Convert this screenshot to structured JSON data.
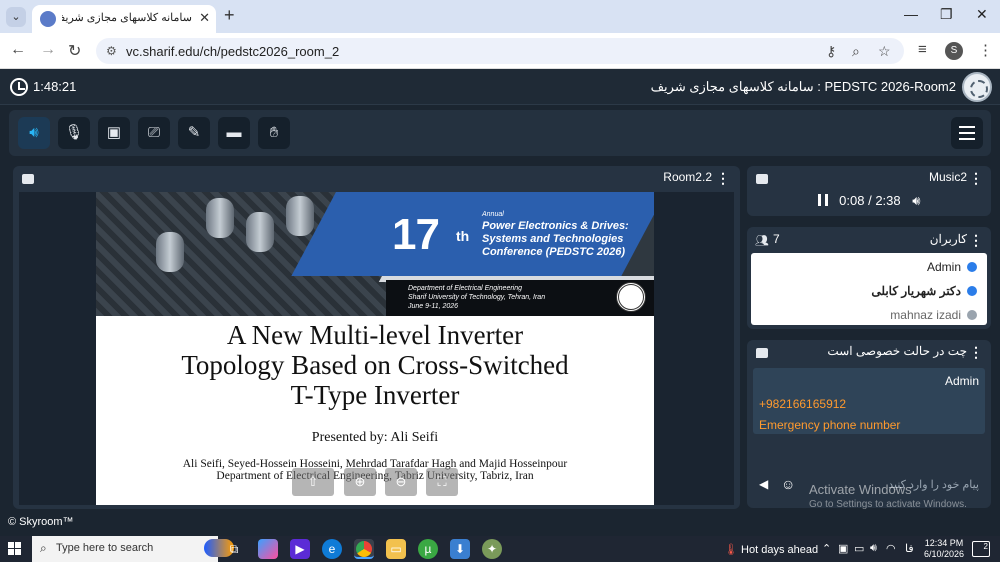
{
  "browser": {
    "tab_title": "سامانه کلاسهای مجازی شریف -",
    "url": "vc.sharif.edu/ch/pedstc2026_room_2",
    "profile_initial": "S"
  },
  "header": {
    "timer": "1:48:21",
    "room_title": "سامانه کلاسهای مجازی شریف : PEDSTC 2026-Room2"
  },
  "presentation": {
    "panel_title": "Room2.2",
    "banner_number": "17",
    "banner_suffix": "th",
    "banner_annual": "Annual",
    "banner_conf": "Power Electronics & Drives: Systems and Technologies Conference (PEDSTC 2026)",
    "banner_dept_line1": "Department of Electrical Engineering",
    "banner_dept_line2": "Sharif University of Technology, Tehran, Iran",
    "banner_dept_line3": "June 9-11, 2026",
    "title_line1": "A New Multi-level Inverter",
    "title_line2": "Topology Based on Cross-Switched",
    "title_line3": "T-Type Inverter",
    "presented_by": "Presented by: Ali Seifi",
    "authors": "Ali Seifi, Seyed-Hossein Hosseini, Mehrdad Tarafdar Hagh and Majid Hosseinpour",
    "department": "Department of Electrical Engineering, Tabriz University, Tabriz, Iran"
  },
  "music": {
    "panel_title": "Music2",
    "current_time": "0:08",
    "separator": "/",
    "duration": "2:38"
  },
  "users": {
    "panel_title": "کاربران",
    "count": "7",
    "list": [
      {
        "name": "Admin",
        "color": "#2b7de9"
      },
      {
        "name": "دکتر شهریار کابلی",
        "color": "#2b7de9"
      },
      {
        "name": "mahnaz izadi",
        "color": "#9aa4ae"
      }
    ]
  },
  "chat": {
    "panel_title": "چت در حالت خصوصی است",
    "sender": "Admin",
    "message_line1": "+982166165912",
    "message_line2": "Emergency phone number",
    "placeholder": "پیام خود را وارد کنید"
  },
  "watermark": {
    "line1": "Activate Windows",
    "line2": "Go to Settings to activate Windows."
  },
  "footer": {
    "brand": "© Skyroom™"
  },
  "taskbar": {
    "search_placeholder": "Type here to search",
    "weather": "Hot days ahead",
    "lang": "فا",
    "time": "12:34 PM",
    "date": "6/10/2026",
    "notifications": "2"
  },
  "colors": {
    "accent": "#29b6f6",
    "chat_message": "#ff9a2e",
    "panel": "#263342",
    "background": "#1b2530"
  }
}
